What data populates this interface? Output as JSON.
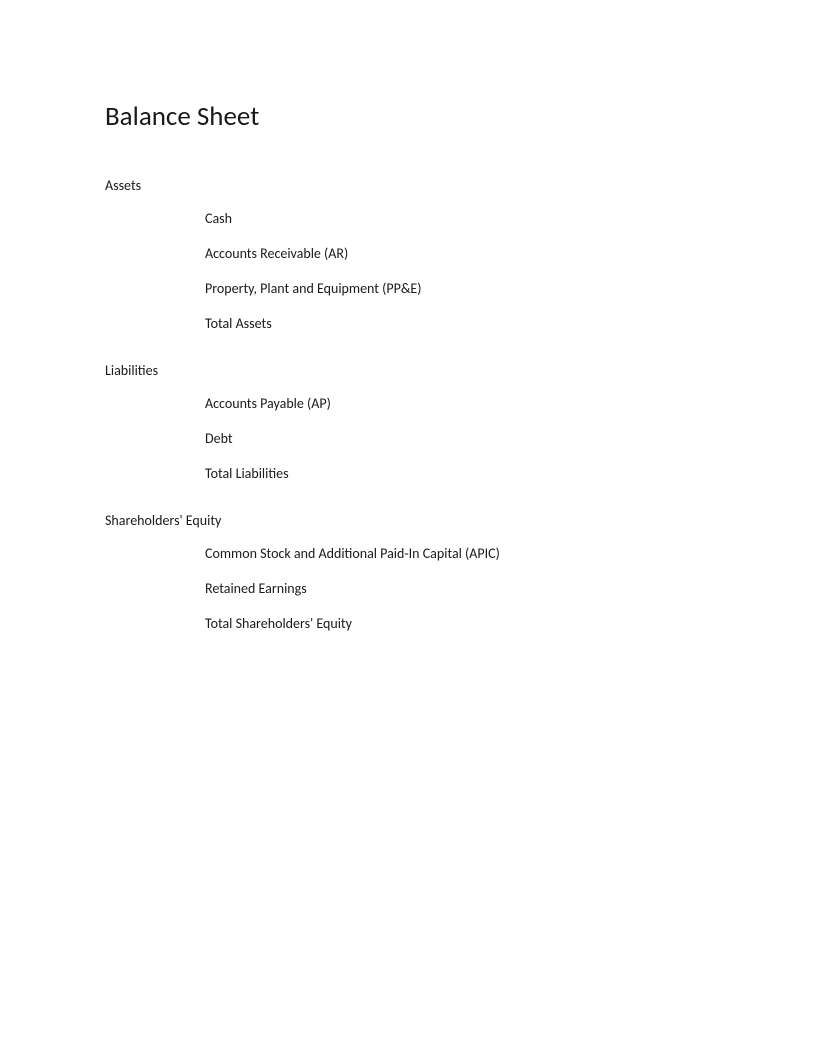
{
  "title": "Balance Sheet",
  "sections": {
    "assets": {
      "header": "Assets",
      "items": [
        "Cash",
        "Accounts Receivable (AR)",
        "Property, Plant and Equipment (PP&E)",
        "Total Assets"
      ]
    },
    "liabilities": {
      "header": "Liabilities",
      "items": [
        "Accounts Payable (AP)",
        "Debt",
        "Total Liabilities"
      ]
    },
    "equity": {
      "header": "Shareholders' Equity",
      "items": [
        "Common Stock and Additional Paid-In Capital (APIC)",
        "Retained Earnings",
        "Total Shareholders' Equity"
      ]
    }
  }
}
